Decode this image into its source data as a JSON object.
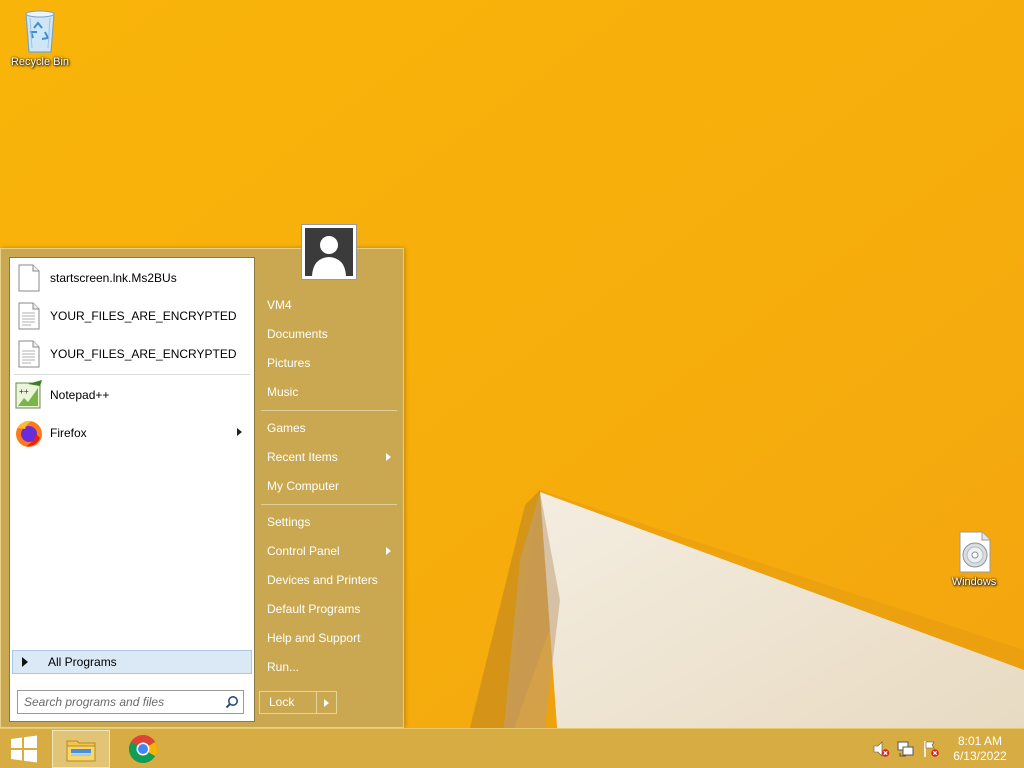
{
  "desktop": {
    "icons": [
      {
        "label": "Recycle Bin",
        "icon": "recycle-bin-icon"
      },
      {
        "label": "Windows",
        "icon": "disc-icon"
      }
    ]
  },
  "start_menu": {
    "recent_files": [
      {
        "label": "startscreen.lnk.Ms2BUs",
        "icon": "file-icon"
      },
      {
        "label": "YOUR_FILES_ARE_ENCRYPTED",
        "icon": "text-file-icon"
      },
      {
        "label": "YOUR_FILES_ARE_ENCRYPTED",
        "icon": "text-file-icon"
      }
    ],
    "pinned_programs": [
      {
        "label": "Notepad++",
        "icon": "notepad-plus-plus-icon"
      },
      {
        "label": "Firefox",
        "icon": "firefox-icon",
        "has_submenu": true
      }
    ],
    "all_programs_label": "All Programs",
    "search": {
      "placeholder": "Search programs and files"
    },
    "right_items_group1": [
      "VM4",
      "Documents",
      "Pictures",
      "Music"
    ],
    "right_items_group2": [
      "Games",
      "Recent Items",
      "My Computer"
    ],
    "right_items_group3": [
      "Settings",
      "Control Panel",
      "Devices and Printers",
      "Default Programs",
      "Help and Support",
      "Run..."
    ],
    "lock_label": "Lock"
  },
  "taskbar": {
    "clock_time": "8:01 AM",
    "clock_date": "6/13/2022",
    "tray_icons": [
      "volume-muted-icon",
      "network-icon",
      "action-center-flag-icon"
    ]
  },
  "colors": {
    "wallpaper": "#f6b10e",
    "start_menu_bg": "#c9a851",
    "taskbar_bg": "#d7ad43",
    "highlight": "#dbe8f5"
  }
}
